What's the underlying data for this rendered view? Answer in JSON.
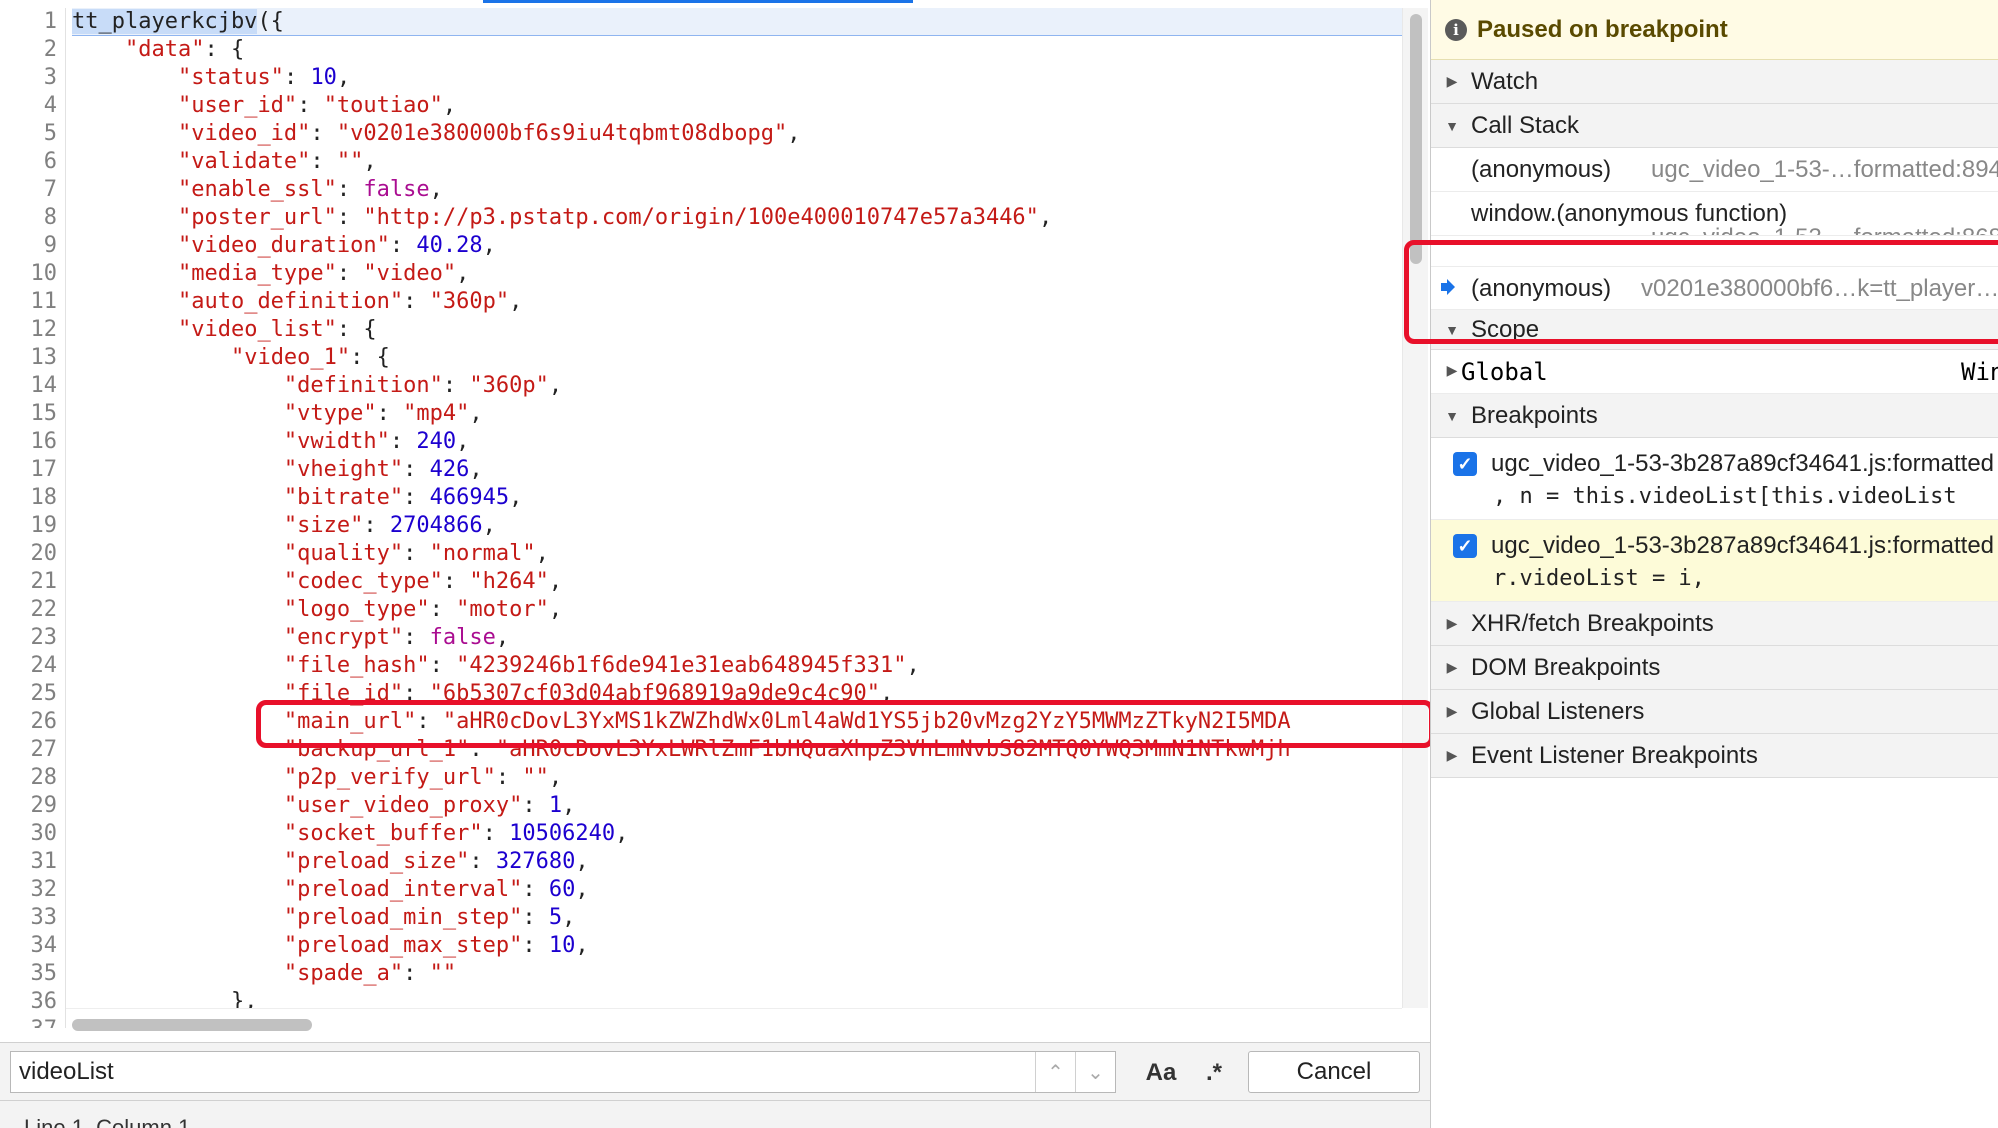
{
  "editor": {
    "lines": [
      {
        "n": "1",
        "segs": [
          [
            "fn",
            "tt_playerkcjbv"
          ],
          [
            "p",
            "({"
          ]
        ]
      },
      {
        "n": "2",
        "segs": [
          [
            "p",
            "    "
          ],
          [
            "k",
            "\"data\""
          ],
          [
            "p",
            ": {"
          ]
        ]
      },
      {
        "n": "3",
        "segs": [
          [
            "p",
            "        "
          ],
          [
            "k",
            "\"status\""
          ],
          [
            "p",
            ": "
          ],
          [
            "num",
            "10"
          ],
          [
            "p",
            ","
          ]
        ]
      },
      {
        "n": "4",
        "segs": [
          [
            "p",
            "        "
          ],
          [
            "k",
            "\"user_id\""
          ],
          [
            "p",
            ": "
          ],
          [
            "str",
            "\"toutiao\""
          ],
          [
            "p",
            ","
          ]
        ]
      },
      {
        "n": "5",
        "segs": [
          [
            "p",
            "        "
          ],
          [
            "k",
            "\"video_id\""
          ],
          [
            "p",
            ": "
          ],
          [
            "str",
            "\"v0201e380000bf6s9iu4tqbmt08dbopg\""
          ],
          [
            "p",
            ","
          ]
        ]
      },
      {
        "n": "6",
        "segs": [
          [
            "p",
            "        "
          ],
          [
            "k",
            "\"validate\""
          ],
          [
            "p",
            ": "
          ],
          [
            "str",
            "\"\""
          ],
          [
            "p",
            ","
          ]
        ]
      },
      {
        "n": "7",
        "segs": [
          [
            "p",
            "        "
          ],
          [
            "k",
            "\"enable_ssl\""
          ],
          [
            "p",
            ": "
          ],
          [
            "bool",
            "false"
          ],
          [
            "p",
            ","
          ]
        ]
      },
      {
        "n": "8",
        "segs": [
          [
            "p",
            "        "
          ],
          [
            "k",
            "\"poster_url\""
          ],
          [
            "p",
            ": "
          ],
          [
            "str",
            "\"http://p3.pstatp.com/origin/100e400010747e57a3446\""
          ],
          [
            "p",
            ","
          ]
        ]
      },
      {
        "n": "9",
        "segs": [
          [
            "p",
            "        "
          ],
          [
            "k",
            "\"video_duration\""
          ],
          [
            "p",
            ": "
          ],
          [
            "num",
            "40.28"
          ],
          [
            "p",
            ","
          ]
        ]
      },
      {
        "n": "10",
        "segs": [
          [
            "p",
            "        "
          ],
          [
            "k",
            "\"media_type\""
          ],
          [
            "p",
            ": "
          ],
          [
            "str",
            "\"video\""
          ],
          [
            "p",
            ","
          ]
        ]
      },
      {
        "n": "11",
        "segs": [
          [
            "p",
            "        "
          ],
          [
            "k",
            "\"auto_definition\""
          ],
          [
            "p",
            ": "
          ],
          [
            "str",
            "\"360p\""
          ],
          [
            "p",
            ","
          ]
        ]
      },
      {
        "n": "12",
        "segs": [
          [
            "p",
            "        "
          ],
          [
            "k",
            "\"video_list\""
          ],
          [
            "p",
            ": {"
          ]
        ]
      },
      {
        "n": "13",
        "segs": [
          [
            "p",
            "            "
          ],
          [
            "k",
            "\"video_1\""
          ],
          [
            "p",
            ": {"
          ]
        ]
      },
      {
        "n": "14",
        "segs": [
          [
            "p",
            "                "
          ],
          [
            "k",
            "\"definition\""
          ],
          [
            "p",
            ": "
          ],
          [
            "str",
            "\"360p\""
          ],
          [
            "p",
            ","
          ]
        ]
      },
      {
        "n": "15",
        "segs": [
          [
            "p",
            "                "
          ],
          [
            "k",
            "\"vtype\""
          ],
          [
            "p",
            ": "
          ],
          [
            "str",
            "\"mp4\""
          ],
          [
            "p",
            ","
          ]
        ]
      },
      {
        "n": "16",
        "segs": [
          [
            "p",
            "                "
          ],
          [
            "k",
            "\"vwidth\""
          ],
          [
            "p",
            ": "
          ],
          [
            "num",
            "240"
          ],
          [
            "p",
            ","
          ]
        ]
      },
      {
        "n": "17",
        "segs": [
          [
            "p",
            "                "
          ],
          [
            "k",
            "\"vheight\""
          ],
          [
            "p",
            ": "
          ],
          [
            "num",
            "426"
          ],
          [
            "p",
            ","
          ]
        ]
      },
      {
        "n": "18",
        "segs": [
          [
            "p",
            "                "
          ],
          [
            "k",
            "\"bitrate\""
          ],
          [
            "p",
            ": "
          ],
          [
            "num",
            "466945"
          ],
          [
            "p",
            ","
          ]
        ]
      },
      {
        "n": "19",
        "segs": [
          [
            "p",
            "                "
          ],
          [
            "k",
            "\"size\""
          ],
          [
            "p",
            ": "
          ],
          [
            "num",
            "2704866"
          ],
          [
            "p",
            ","
          ]
        ]
      },
      {
        "n": "20",
        "segs": [
          [
            "p",
            "                "
          ],
          [
            "k",
            "\"quality\""
          ],
          [
            "p",
            ": "
          ],
          [
            "str",
            "\"normal\""
          ],
          [
            "p",
            ","
          ]
        ]
      },
      {
        "n": "21",
        "segs": [
          [
            "p",
            "                "
          ],
          [
            "k",
            "\"codec_type\""
          ],
          [
            "p",
            ": "
          ],
          [
            "str",
            "\"h264\""
          ],
          [
            "p",
            ","
          ]
        ]
      },
      {
        "n": "22",
        "segs": [
          [
            "p",
            "                "
          ],
          [
            "k",
            "\"logo_type\""
          ],
          [
            "p",
            ": "
          ],
          [
            "str",
            "\"motor\""
          ],
          [
            "p",
            ","
          ]
        ]
      },
      {
        "n": "23",
        "segs": [
          [
            "p",
            "                "
          ],
          [
            "k",
            "\"encrypt\""
          ],
          [
            "p",
            ": "
          ],
          [
            "bool",
            "false"
          ],
          [
            "p",
            ","
          ]
        ]
      },
      {
        "n": "24",
        "segs": [
          [
            "p",
            "                "
          ],
          [
            "k",
            "\"file_hash\""
          ],
          [
            "p",
            ": "
          ],
          [
            "str",
            "\"4239246b1f6de941e31eab648945f331\""
          ],
          [
            "p",
            ","
          ]
        ]
      },
      {
        "n": "25",
        "segs": [
          [
            "p",
            "                "
          ],
          [
            "k",
            "\"file_id\""
          ],
          [
            "p",
            ": "
          ],
          [
            "str",
            "\"6b5307cf03d04abf968919a9de9c4c90\""
          ],
          [
            "p",
            ","
          ]
        ]
      },
      {
        "n": "26",
        "segs": [
          [
            "p",
            "                "
          ],
          [
            "k",
            "\"main_url\""
          ],
          [
            "p",
            ": "
          ],
          [
            "str",
            "\"aHR0cDovL3YxMS1kZWZhdWx0Lml4aWd1YS5jb20vMzg2YzY5MWMzZTkyN2I5MDA"
          ]
        ]
      },
      {
        "n": "27",
        "segs": [
          [
            "p",
            "                "
          ],
          [
            "k",
            "\"backup_url_1\""
          ],
          [
            "p",
            ": "
          ],
          [
            "str",
            "\"aHR0cDovL3YxLWRlZmF1bHQuaXhpZ3VhLmNvbS82MTQ0YWQ3MmN1NTkwMjh"
          ]
        ]
      },
      {
        "n": "28",
        "segs": [
          [
            "p",
            "                "
          ],
          [
            "k",
            "\"p2p_verify_url\""
          ],
          [
            "p",
            ": "
          ],
          [
            "str",
            "\"\""
          ],
          [
            "p",
            ","
          ]
        ]
      },
      {
        "n": "29",
        "segs": [
          [
            "p",
            "                "
          ],
          [
            "k",
            "\"user_video_proxy\""
          ],
          [
            "p",
            ": "
          ],
          [
            "num",
            "1"
          ],
          [
            "p",
            ","
          ]
        ]
      },
      {
        "n": "30",
        "segs": [
          [
            "p",
            "                "
          ],
          [
            "k",
            "\"socket_buffer\""
          ],
          [
            "p",
            ": "
          ],
          [
            "num",
            "10506240"
          ],
          [
            "p",
            ","
          ]
        ]
      },
      {
        "n": "31",
        "segs": [
          [
            "p",
            "                "
          ],
          [
            "k",
            "\"preload_size\""
          ],
          [
            "p",
            ": "
          ],
          [
            "num",
            "327680"
          ],
          [
            "p",
            ","
          ]
        ]
      },
      {
        "n": "32",
        "segs": [
          [
            "p",
            "                "
          ],
          [
            "k",
            "\"preload_interval\""
          ],
          [
            "p",
            ": "
          ],
          [
            "num",
            "60"
          ],
          [
            "p",
            ","
          ]
        ]
      },
      {
        "n": "33",
        "segs": [
          [
            "p",
            "                "
          ],
          [
            "k",
            "\"preload_min_step\""
          ],
          [
            "p",
            ": "
          ],
          [
            "num",
            "5"
          ],
          [
            "p",
            ","
          ]
        ]
      },
      {
        "n": "34",
        "segs": [
          [
            "p",
            "                "
          ],
          [
            "k",
            "\"preload_max_step\""
          ],
          [
            "p",
            ": "
          ],
          [
            "num",
            "10"
          ],
          [
            "p",
            ","
          ]
        ]
      },
      {
        "n": "35",
        "segs": [
          [
            "p",
            "                "
          ],
          [
            "k",
            "\"spade_a\""
          ],
          [
            "p",
            ": "
          ],
          [
            "str",
            "\"\""
          ]
        ]
      },
      {
        "n": "36",
        "segs": [
          [
            "p",
            "            },"
          ]
        ]
      },
      {
        "n": "37",
        "segs": [
          [
            "p",
            ""
          ]
        ]
      }
    ],
    "search_value": "videoList",
    "aa_label": "Aa",
    "regex_label": ".*",
    "cancel_label": "Cancel",
    "status_text": "Line 1, Column 1"
  },
  "sidebar": {
    "paused_text": "Paused on breakpoint",
    "info_icon": "i",
    "watch_label": "Watch",
    "call_stack_label": "Call Stack",
    "call_stack": [
      {
        "fn": "(anonymous)",
        "loc": "ugc_video_1-53-…formatted:894"
      },
      {
        "fn": "window.(anonymous function)",
        "loc": "ugc_video_1-53-…formatted:868"
      },
      {
        "fn": "(anonymous)",
        "loc": "v0201e380000bf6…k=tt_player…"
      }
    ],
    "scope_label": "Scope",
    "global_label": "Global",
    "global_value": "Win",
    "breakpoints_label": "Breakpoints",
    "breakpoints": [
      {
        "file": "ugc_video_1-53-3b287a89cf34641.js:formatted",
        "code": ", n = this.videoList[this.videoList"
      },
      {
        "file": "ugc_video_1-53-3b287a89cf34641.js:formatted",
        "code": "r.videoList = i,"
      }
    ],
    "xhr_label": "XHR/fetch Breakpoints",
    "dom_label": "DOM Breakpoints",
    "global_listeners_label": "Global Listeners",
    "event_listener_label": "Event Listener Breakpoints"
  },
  "colors": {
    "annotation_red": "#e8102a",
    "accent_blue": "#1a73e8",
    "paused_bg": "#fffbe5"
  }
}
